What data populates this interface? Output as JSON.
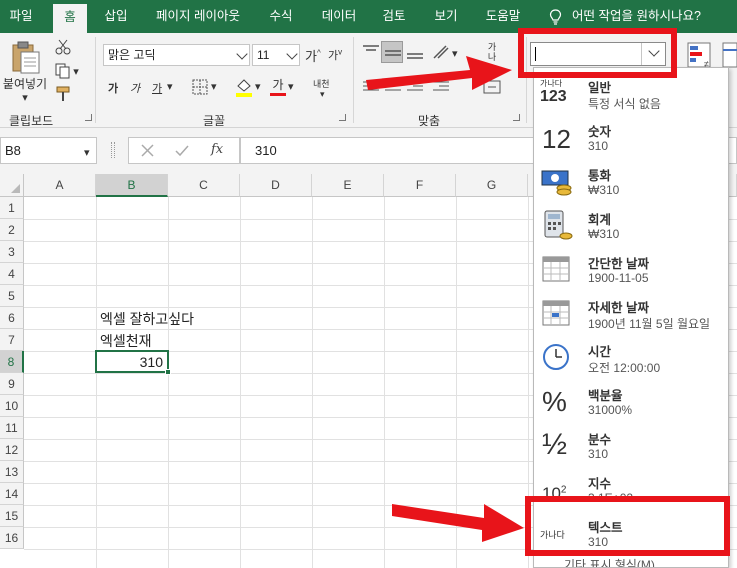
{
  "ribbon_tabs": [
    "파일",
    "홈",
    "삽입",
    "페이지 레이아웃",
    "수식",
    "데이터",
    "검토",
    "보기",
    "도움말"
  ],
  "tell_me": "어떤 작업을 원하시나요?",
  "clipboard": {
    "paste_label": "붙여넣기",
    "group_label": "클립보드"
  },
  "font": {
    "name": "맑은 고딕",
    "size": "11",
    "bold": "가",
    "italic": "가",
    "underline": "가",
    "font_color_glyph": "가",
    "phonetic": "내천",
    "grow": "가",
    "shrink": "가",
    "group_label": "글꼴"
  },
  "alignment": {
    "wrap_glyph": "가나",
    "group_label": "맞춤"
  },
  "formula_bar": {
    "name_box": "B8",
    "fx": "fx",
    "formula": "310"
  },
  "columns": [
    "A",
    "B",
    "C",
    "D",
    "E",
    "F",
    "G"
  ],
  "rows": [
    "1",
    "2",
    "3",
    "4",
    "5",
    "6",
    "7",
    "8",
    "9",
    "10",
    "11",
    "12",
    "13",
    "14",
    "15",
    "16"
  ],
  "cells": {
    "B6": "엑셀 잘하고싶다",
    "B7": "엑셀천재",
    "B8": "310"
  },
  "number_format_dropdown": {
    "items": [
      {
        "name": "일반",
        "sample": "특정 서식 없음",
        "icon": "general-icon",
        "icon_text": "123",
        "icon_sub": "가나다"
      },
      {
        "name": "숫자",
        "sample": "310",
        "icon": "number-icon",
        "icon_text": "12"
      },
      {
        "name": "통화",
        "sample": "₩310",
        "icon": "currency-icon"
      },
      {
        "name": "회계",
        "sample": " ₩310",
        "icon": "accounting-icon"
      },
      {
        "name": "간단한 날짜",
        "sample": "1900-11-05",
        "icon": "short-date-icon"
      },
      {
        "name": "자세한 날짜",
        "sample": "1900년 11월 5일 월요일",
        "icon": "long-date-icon"
      },
      {
        "name": "시간",
        "sample": "오전 12:00:00",
        "icon": "clock-icon"
      },
      {
        "name": "백분율",
        "sample": "31000%",
        "icon": "percent-icon",
        "icon_text": "%"
      },
      {
        "name": "분수",
        "sample": "310",
        "icon": "fraction-icon",
        "icon_text": "½"
      },
      {
        "name": "지수",
        "sample": "3.1E+02",
        "icon": "scientific-icon",
        "icon_text": "10",
        "icon_sup": "2"
      },
      {
        "name": "텍스트",
        "sample": "310",
        "icon": "text-icon",
        "icon_text": "가나다"
      }
    ],
    "more": "기타 표시 형식(M)..."
  },
  "colors": {
    "excel_green": "#217346",
    "annotation_red": "#e8141a"
  }
}
